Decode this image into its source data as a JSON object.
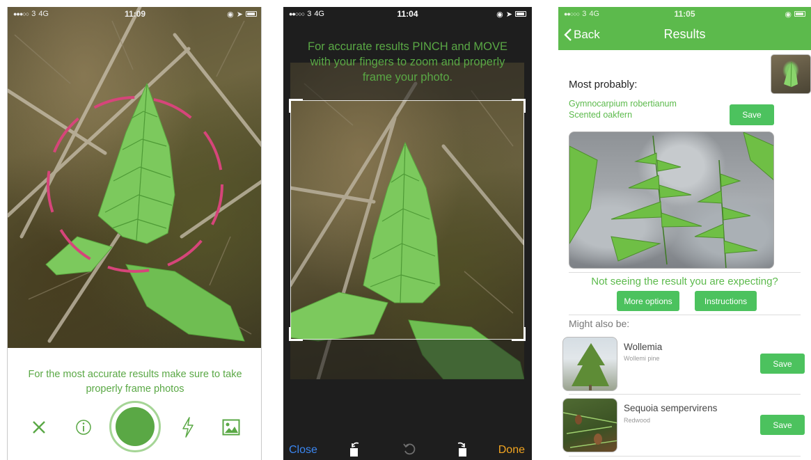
{
  "colors": {
    "accent": "#5aa845",
    "results_header": "#5cba4c",
    "save_button": "#4cc25e",
    "ios_blue": "#3b86f0",
    "ios_orange": "#f2a521",
    "target_ring": "#d6457a"
  },
  "screen1": {
    "status": {
      "carrier": "3",
      "network": "4G",
      "time": "11:09"
    },
    "hint": "For the most accurate results make sure to take properly frame photos",
    "toolbar_icons": [
      "close-icon",
      "info-icon",
      "shutter-button",
      "flash-icon",
      "gallery-icon"
    ]
  },
  "screen2": {
    "status": {
      "carrier": "3",
      "network": "4G",
      "time": "11:04"
    },
    "hint": "For accurate results PINCH and MOVE with your fingers to zoom and properly frame your photo.",
    "toolbar": {
      "close_label": "Close",
      "done_label": "Done",
      "icons": [
        "rotate-left-icon",
        "reset-rotate-icon",
        "rotate-right-icon"
      ]
    }
  },
  "screen3": {
    "status": {
      "carrier": "3",
      "network": "4G",
      "time": "11:05"
    },
    "back_label": "Back",
    "title": "Results",
    "most_probably_label": "Most probably:",
    "top_result": {
      "scientific": "Gymnocarpium robertianum",
      "common": "Scented oakfern",
      "save_label": "Save"
    },
    "not_seeing": "Not seeing the result you are expecting?",
    "more_options_label": "More options",
    "instructions_label": "Instructions",
    "might_also_be_label": "Might also be:",
    "alternatives": [
      {
        "scientific": "Wollemia",
        "common": "Wollemi pine",
        "save_label": "Save"
      },
      {
        "scientific": "Sequoia sempervirens",
        "common": "Redwood",
        "save_label": "Save"
      }
    ]
  }
}
